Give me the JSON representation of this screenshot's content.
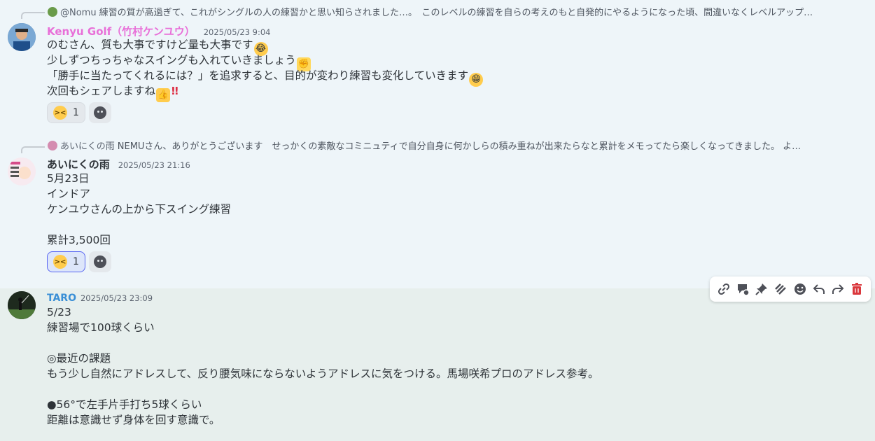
{
  "messages": [
    {
      "reply": {
        "name": "@Nomu",
        "text": "練習の質が高過ぎて、これがシングルの人の練習かと思い知らされました…。　このレベルの練習を自らの考えのもと自発的にやるようになった頃、間違いなくレベルアップ…"
      },
      "author": "Kenyu Golf（竹村ケンユウ）",
      "author_color": "#e86fd8",
      "timestamp": "2025/05/23 9:04",
      "lines": [
        "のむさん、質も大事ですけど量も大事です",
        "少しずつちっちゃなスイングも入れていきましょう",
        "「勝手に当たってくれるには？」を追求すると、目的が変わり練習も変化していきます",
        "次回もシェアしますね"
      ],
      "reaction_count": "1"
    },
    {
      "reply": {
        "name": "あいにくの雨",
        "text": "NEMUさん、ありがとうございます　せっかくの素敵なコミニュティで自分自身に何かしらの積み重ねが出来たらなと累計をメモってたら楽しくなってきました。 よ…"
      },
      "author": "あいにくの雨",
      "author_color": "#2e3338",
      "timestamp": "2025/05/23 21:16",
      "lines": [
        "5月23日",
        "インドア",
        "ケンユウさんの上から下スイング練習",
        "",
        "累計3,500回"
      ],
      "reaction_count": "1"
    },
    {
      "author": "TARO",
      "author_color": "#3a8fd6",
      "timestamp": "2025/05/23 23:09",
      "lines": [
        "5/23",
        "練習場で100球くらい",
        "",
        "◎最近の課題",
        "もう少し自然にアドレスして、反り腰気味にならないようアドレスに気をつける。馬場咲希プロのアドレス参考。",
        "",
        "●56°で左手片手打ち5球くらい",
        "距離は意識せず身体を回す意識で。"
      ]
    }
  ],
  "toolbar_icons": [
    "link-icon",
    "thread-icon",
    "pin-icon",
    "apps-icon",
    "add-reaction-icon",
    "reply-icon",
    "forward-icon",
    "delete-icon"
  ]
}
